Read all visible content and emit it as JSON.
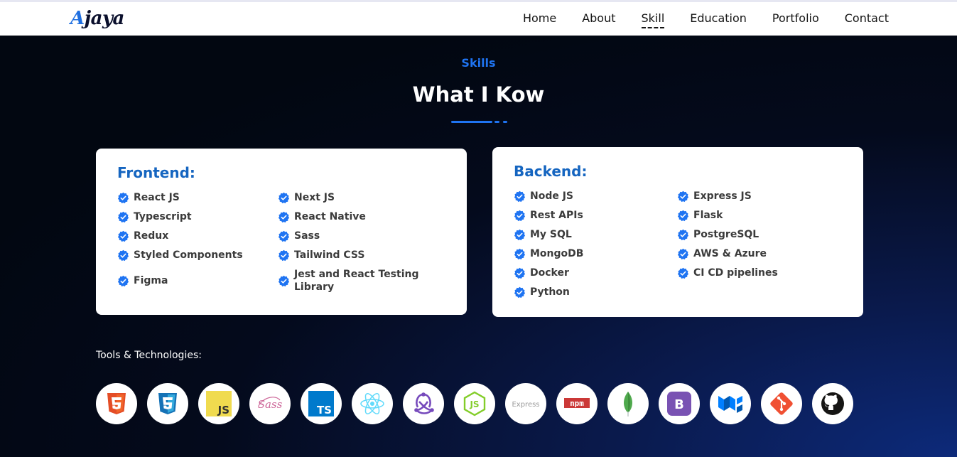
{
  "brand": {
    "first_letter": "A",
    "rest": "jaya"
  },
  "nav": {
    "items": [
      "Home",
      "About",
      "Skill",
      "Education",
      "Portfolio",
      "Contact"
    ],
    "active": "Skill"
  },
  "section": {
    "eyebrow": "Skills",
    "heading": "What I Kow"
  },
  "frontend": {
    "title": "Frontend:",
    "skills": [
      "React JS",
      "Next JS",
      "Typescript",
      "React Native",
      "Redux",
      "Sass",
      "Styled Components",
      "Tailwind CSS",
      "Figma",
      "Jest and React Testing Library"
    ]
  },
  "backend": {
    "title": "Backend:",
    "skills": [
      "Node JS",
      "Express JS",
      "Rest APIs",
      "Flask",
      "My SQL",
      "PostgreSQL",
      "MongoDB",
      "AWS & Azure",
      "Docker",
      "CI CD pipelines",
      "Python"
    ]
  },
  "tools": {
    "label": "Tools & Technologies:",
    "items": [
      {
        "name": "html5-icon"
      },
      {
        "name": "css3-icon"
      },
      {
        "name": "javascript-icon"
      },
      {
        "name": "sass-icon"
      },
      {
        "name": "typescript-icon"
      },
      {
        "name": "react-icon"
      },
      {
        "name": "redux-icon"
      },
      {
        "name": "nodejs-icon"
      },
      {
        "name": "express-icon"
      },
      {
        "name": "npm-icon"
      },
      {
        "name": "mongodb-icon"
      },
      {
        "name": "bootstrap-icon"
      },
      {
        "name": "material-ui-icon"
      },
      {
        "name": "git-icon"
      },
      {
        "name": "github-icon"
      }
    ],
    "texts": {
      "js": "JS",
      "ts": "TS",
      "express": "Express",
      "npm": "npm",
      "bootstrap": "B",
      "sass": "Sass"
    }
  },
  "colors": {
    "accent": "#1f74f2",
    "card_title": "#1565c0",
    "check": "#1f74f2"
  }
}
